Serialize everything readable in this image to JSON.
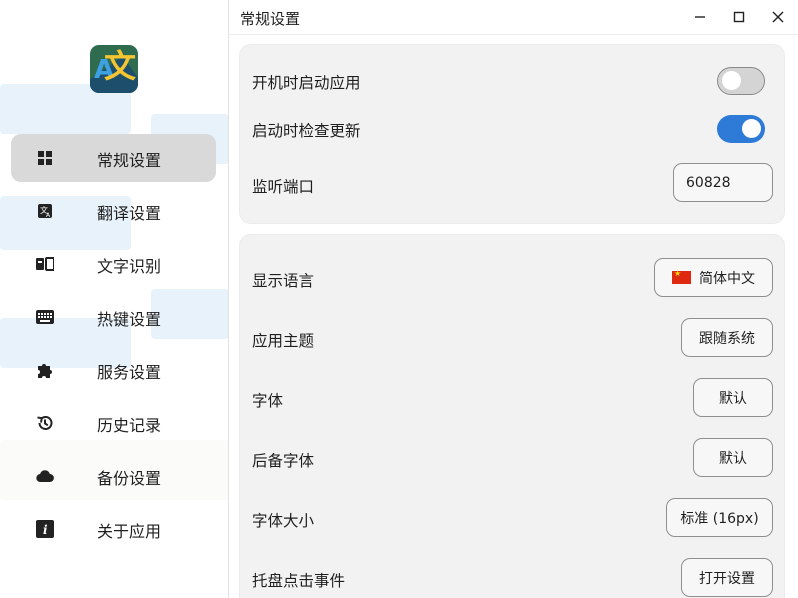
{
  "window": {
    "title": "常规设置"
  },
  "sidebar": {
    "items": [
      {
        "label": "常规设置",
        "icon": "grid-icon"
      },
      {
        "label": "翻译设置",
        "icon": "translate-icon"
      },
      {
        "label": "文字识别",
        "icon": "ocr-icon"
      },
      {
        "label": "热键设置",
        "icon": "keyboard-icon"
      },
      {
        "label": "服务设置",
        "icon": "puzzle-icon"
      },
      {
        "label": "历史记录",
        "icon": "history-icon"
      },
      {
        "label": "备份设置",
        "icon": "cloud-icon"
      },
      {
        "label": "关于应用",
        "icon": "info-icon"
      }
    ],
    "active_index": 0
  },
  "general": {
    "autostart_label": "开机时启动应用",
    "autostart_on": false,
    "check_update_label": "启动时检查更新",
    "check_update_on": true,
    "port_label": "监听端口",
    "port_value": "60828"
  },
  "appearance": {
    "language_label": "显示语言",
    "language_value": "简体中文",
    "theme_label": "应用主题",
    "theme_value": "跟随系统",
    "font_label": "字体",
    "font_value": "默认",
    "fallback_font_label": "后备字体",
    "fallback_font_value": "默认",
    "font_size_label": "字体大小",
    "font_size_value": "标准 (16px)",
    "tray_click_label": "托盘点击事件",
    "tray_click_value": "打开设置"
  },
  "colors": {
    "accent": "#2d7ad7",
    "active_nav": "#d9d9d9",
    "card": "#f2f2f2"
  }
}
